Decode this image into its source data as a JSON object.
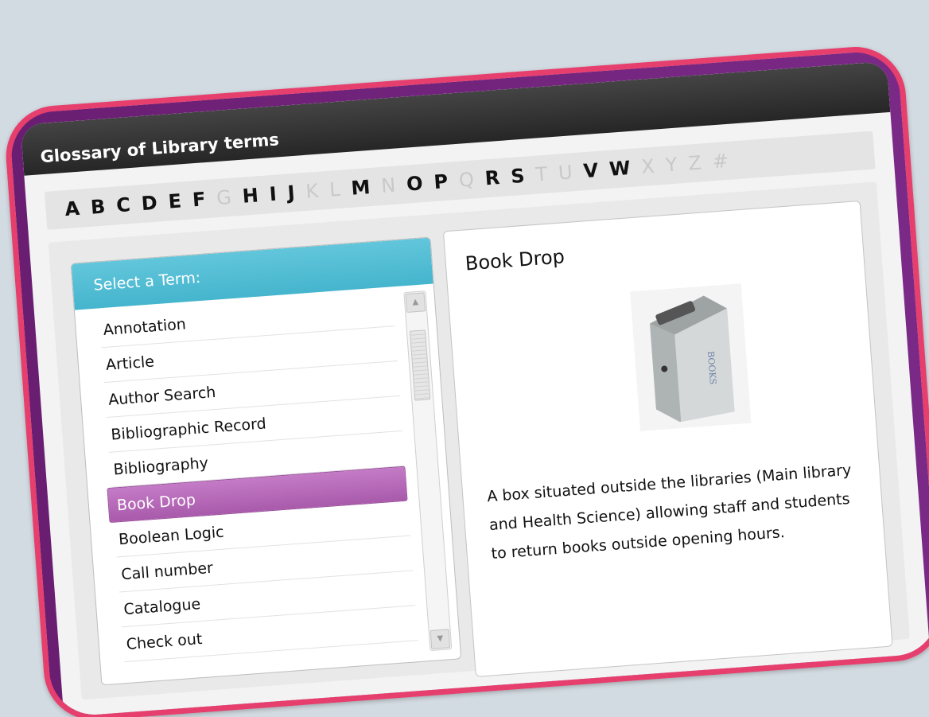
{
  "window": {
    "title": "Glossary of Library terms"
  },
  "alphabet": [
    {
      "letter": "A",
      "enabled": true
    },
    {
      "letter": "B",
      "enabled": true
    },
    {
      "letter": "C",
      "enabled": true
    },
    {
      "letter": "D",
      "enabled": true
    },
    {
      "letter": "E",
      "enabled": true
    },
    {
      "letter": "F",
      "enabled": true
    },
    {
      "letter": "G",
      "enabled": false
    },
    {
      "letter": "H",
      "enabled": true
    },
    {
      "letter": "I",
      "enabled": true
    },
    {
      "letter": "J",
      "enabled": true
    },
    {
      "letter": "K",
      "enabled": false
    },
    {
      "letter": "L",
      "enabled": false
    },
    {
      "letter": "M",
      "enabled": true
    },
    {
      "letter": "N",
      "enabled": false
    },
    {
      "letter": "O",
      "enabled": true
    },
    {
      "letter": "P",
      "enabled": true
    },
    {
      "letter": "Q",
      "enabled": false
    },
    {
      "letter": "R",
      "enabled": true
    },
    {
      "letter": "S",
      "enabled": true
    },
    {
      "letter": "T",
      "enabled": false
    },
    {
      "letter": "U",
      "enabled": false
    },
    {
      "letter": "V",
      "enabled": true
    },
    {
      "letter": "W",
      "enabled": true
    },
    {
      "letter": "X",
      "enabled": false
    },
    {
      "letter": "Y",
      "enabled": false
    },
    {
      "letter": "Z",
      "enabled": false
    },
    {
      "letter": "#",
      "enabled": false
    }
  ],
  "term_panel": {
    "header": "Select a Term:",
    "selected_index": 5,
    "terms": [
      "Annotation",
      "Article",
      "Author Search",
      "Bibliographic Record",
      "Bibliography",
      "Book Drop",
      "Boolean Logic",
      "Call number",
      "Catalogue",
      "Check out"
    ]
  },
  "detail": {
    "title": "Book Drop",
    "image_label": "BOOKS",
    "description": "A box situated outside the libraries (Main library and Health Science) allowing staff and students to return books outside opening hours."
  },
  "colors": {
    "frame_border": "#e63e6d",
    "frame_bg": "#6a1e72",
    "term_header": "#45b5cd",
    "selected_term": "#a95aab"
  }
}
